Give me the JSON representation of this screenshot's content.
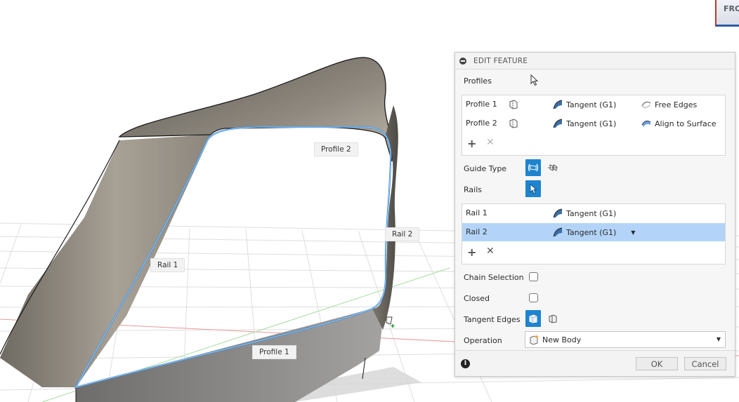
{
  "viewport": {
    "labels": {
      "profile_1": "Profile 1",
      "profile_2": "Profile 2",
      "rail_1": "Rail 1",
      "rail_2": "Rail 2"
    },
    "viewcube_text": "FRO"
  },
  "panel": {
    "title": "EDIT FEATURE",
    "profiles_label": "Profiles",
    "profiles": [
      {
        "name": "Profile 1",
        "continuity": "Tangent (G1)",
        "edge_option": "Free Edges"
      },
      {
        "name": "Profile 2",
        "continuity": "Tangent (G1)",
        "edge_option": "Align to Surface"
      }
    ],
    "guide_type_label": "Guide Type",
    "rails_label": "Rails",
    "rails": [
      {
        "name": "Rail 1",
        "continuity": "Tangent (G1)",
        "selected": false
      },
      {
        "name": "Rail 2",
        "continuity": "Tangent (G1)",
        "selected": true
      }
    ],
    "chain_selection_label": "Chain Selection",
    "closed_label": "Closed",
    "tangent_edges_label": "Tangent Edges",
    "operation_label": "Operation",
    "operation_value": "New Body",
    "ok_label": "OK",
    "cancel_label": "Cancel"
  },
  "colors": {
    "accent": "#1e84cf",
    "selection_row": "#b3d4f8",
    "edge_highlight": "#2f86d8",
    "surface": "#8b857b"
  },
  "icons": [
    "collapse-icon",
    "cursor-icon",
    "profile-point-icon",
    "tangent-icon",
    "free-edges-icon",
    "align-surface-icon",
    "add-icon",
    "remove-icon",
    "guide-rails-icon",
    "guide-centerline-icon",
    "select-arrow-icon",
    "dropdown-caret-icon",
    "tangent-edges-solid-icon",
    "tangent-edges-open-icon",
    "new-body-icon",
    "info-icon",
    "selection-plus-icon"
  ]
}
